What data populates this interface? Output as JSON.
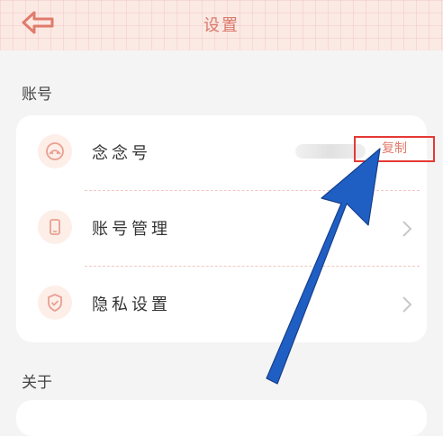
{
  "header": {
    "title": "设置",
    "back_icon": "back-arrow-icon"
  },
  "sections": [
    {
      "title": "账号",
      "items": [
        {
          "label": "念念号",
          "icon": "avatar-icon",
          "action_label": "复制"
        },
        {
          "label": "账号管理",
          "icon": "phone-icon"
        },
        {
          "label": "隐私设置",
          "icon": "shield-icon"
        }
      ]
    },
    {
      "title": "关于"
    }
  ],
  "colors": {
    "accent": "#d9796b",
    "header_bg": "#fbe9e4",
    "icon_bg": "#fdeee8",
    "highlight_box": "#e53935",
    "annotation_arrow": "#1f5fc4"
  }
}
